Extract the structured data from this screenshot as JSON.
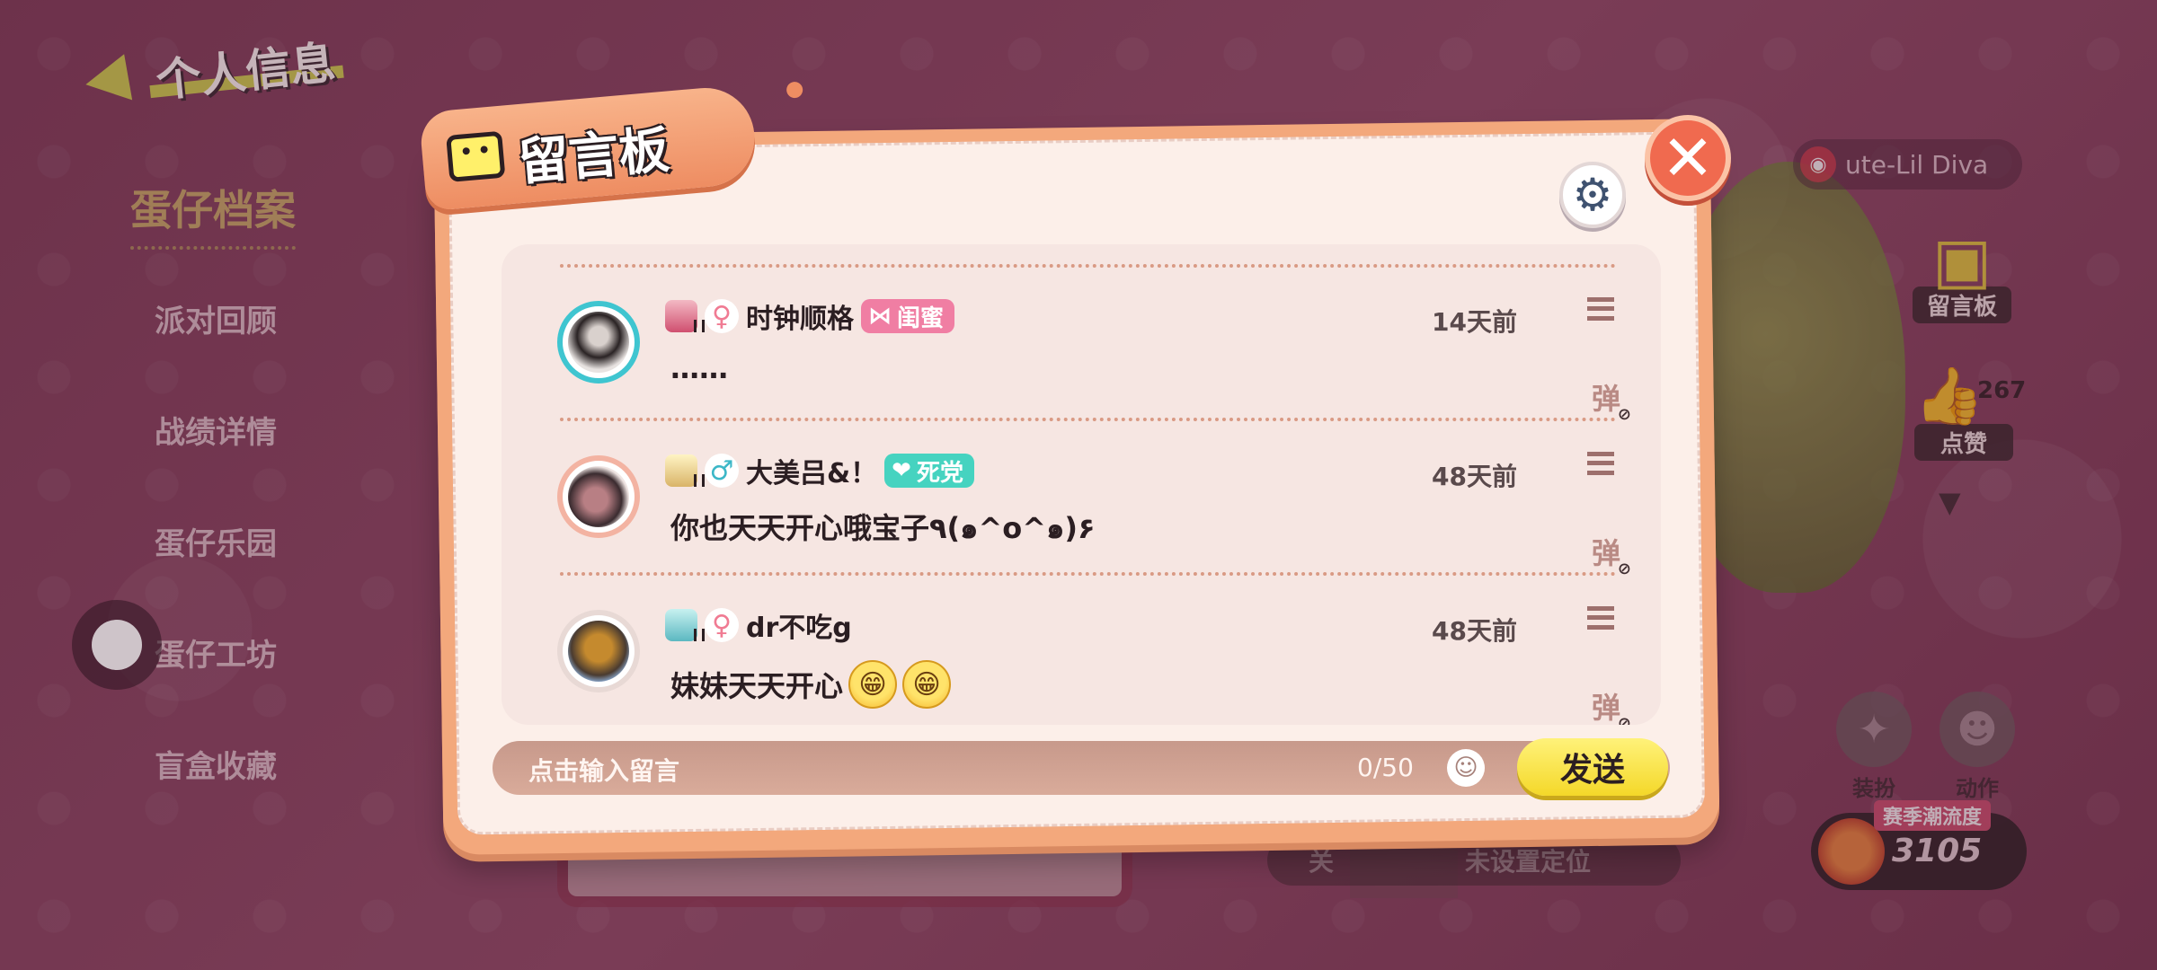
{
  "background": {
    "back_title": "个人信息",
    "profile_heading": "蛋仔档案",
    "side_menu": [
      "派对回顾",
      "战绩详情",
      "蛋仔乐园",
      "蛋仔工坊",
      "盲盒收藏"
    ],
    "player_name": "ute-Lil Diva",
    "board_label": "留言板",
    "like_label": "点赞",
    "like_count": "267",
    "dress_label": "装扮",
    "action_label": "动作",
    "season_label": "赛季潮流度",
    "season_value": "3105",
    "location_toggle": "关",
    "location_text": "未设置定位"
  },
  "modal": {
    "title": "留言板",
    "messages": [
      {
        "username": "时钟顺格",
        "gender": "♀",
        "relation_tag": "闺蜜",
        "relation_icon": "bow-icon",
        "time": "14天前",
        "text": "……",
        "emojis": []
      },
      {
        "username": "大美吕&！",
        "gender": "♂",
        "relation_tag": "死党",
        "relation_icon": "heart-icon",
        "time": "48天前",
        "text": "你也天天开心哦宝子٩(๑^o^๑)۶",
        "emojis": []
      },
      {
        "username": "dr不吃g",
        "gender": "♀",
        "relation_tag": "",
        "relation_icon": "",
        "time": "48天前",
        "text": "妹妹天天开心",
        "emojis": [
          "😁",
          "😁"
        ]
      }
    ],
    "danmu_label": "弹",
    "input_placeholder": "点击输入留言",
    "char_count": "0/50",
    "send_label": "发送"
  },
  "colors": {
    "modal_frame": "#f3a87c",
    "modal_paper": "#fcefe9",
    "send_button": "#f4d829",
    "close_button": "#f06a4f",
    "tag_bestie": "#f07ea3",
    "tag_buddy": "#46d3c0"
  }
}
